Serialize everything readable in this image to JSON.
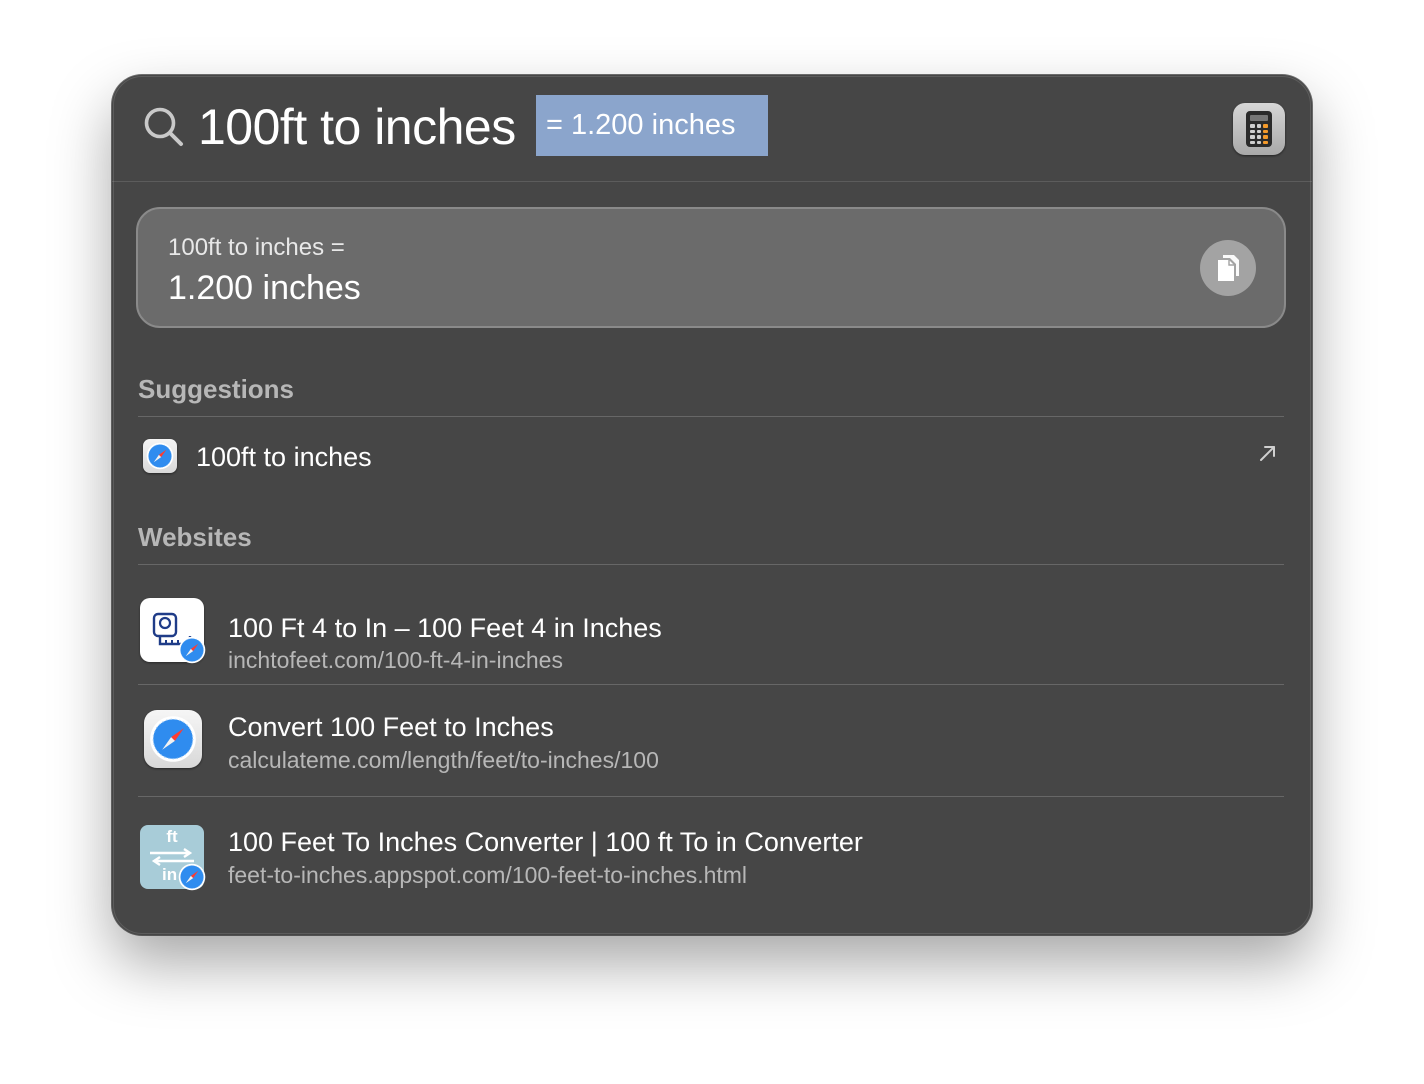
{
  "search": {
    "query": "100ft to inches",
    "inline_completion": "= 1.200 inches"
  },
  "top_hit": {
    "app_icon": "calculator-app-icon",
    "expression": "100ft to inches =",
    "result": "1.200 inches",
    "copy_icon": "copy-icon"
  },
  "suggestions": {
    "header": "Suggestions",
    "items": [
      {
        "label": "100ft to inches",
        "icon": "safari-icon",
        "action_icon": "open-arrow-icon"
      }
    ]
  },
  "websites": {
    "header": "Websites",
    "items": [
      {
        "title": "100 Ft 4 to In – 100 Feet 4 in Inches",
        "url": "inchtofeet.com/100-ft-4-in-inches",
        "icon": "tape-measure-icon"
      },
      {
        "title": "Convert 100 Feet to Inches",
        "url": "calculateme.com/length/feet/to-inches/100",
        "icon": "safari-icon"
      },
      {
        "title": "100 Feet To Inches Converter | 100 ft To in Converter",
        "url": "feet-to-inches.appspot.com/100-feet-to-inches.html",
        "icon": "ft-to-in-icon",
        "icon_text_top": "ft",
        "icon_text_bottom": "in"
      }
    ]
  },
  "colors": {
    "panel_background": "#464646",
    "result_card": "#6b6b6b",
    "selection_highlight": "#8ba5cc",
    "secondary_text": "#b7b7b7"
  }
}
